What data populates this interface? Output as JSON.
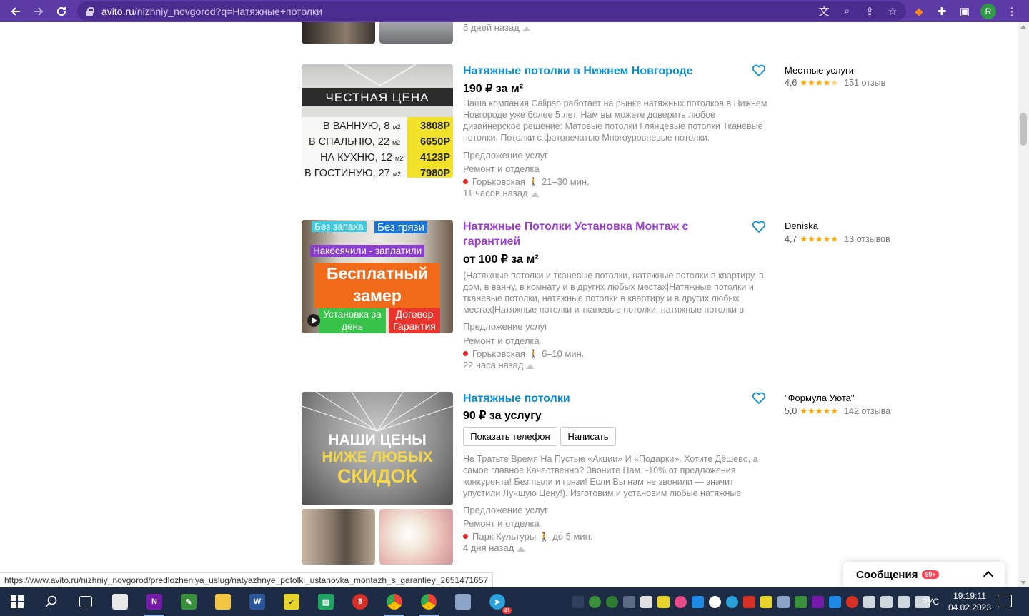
{
  "browser": {
    "url_host": "avito.ru",
    "url_rest": "/nizhniy_novgorod?q=Натяжные+потолки",
    "avatar_letter": "R"
  },
  "partial_top": {
    "time": "5 дней назад"
  },
  "listings": [
    {
      "title": "Натяжные потолки в Нижнем Новгороде",
      "price": "190 ₽ за м²",
      "description": "Наша компания Calipso работает на рынке натяжных потолков в Нижнем Новгороде уже более 5 лет. Нам вы можете доверить любое дизайнерское решение: Матовые потолки Глянцевые потолки Тканевые потолки. Потолки с фотопечатью Многоуровневые потолки.",
      "category1": "Предложение услуг",
      "category2": "Ремонт и отделка",
      "metro": "Горьковская",
      "walk": "21–30 мин.",
      "time": "11 часов назад",
      "seller": "Местные услуги",
      "rating": "4,6",
      "reviews": "151 отзыв",
      "image_text": {
        "header": "ЧЕСТНАЯ ЦЕНА",
        "rows": [
          {
            "label": "В ВАННУЮ, 8",
            "unit": "м2",
            "price": "3808Р"
          },
          {
            "label": "В СПАЛЬНЮ, 22",
            "unit": "м2",
            "price": "6650Р"
          },
          {
            "label": "НА КУХНЮ, 12",
            "unit": "м2",
            "price": "4123Р"
          },
          {
            "label": "В ГОСТИНУЮ, 27",
            "unit": "м2",
            "price": "7980Р"
          }
        ]
      }
    },
    {
      "title": "Натяжные Потолки Установка Монтаж с гарантией",
      "price": "от 100 ₽ за м²",
      "description": "{Натяжные потолки и тканевые потолки, натяжные потолки в квартиру, в дом, в ванну, в комнату и в других любых местах|Натяжные потолки и тканевые потолки, натяжные потолки в квартиру и в других любых местах|Натяжные потолки и тканевые потолки, натяжные потолки в",
      "category1": "Предложение услуг",
      "category2": "Ремонт и отделка",
      "metro": "Горьковская",
      "walk": "6–10 мин.",
      "time": "22 часа назад",
      "seller": "Deniska",
      "rating": "4,7",
      "reviews": "13 отзывов",
      "image_text": {
        "tag1": "Без запаха",
        "tag2": "Без грязи",
        "tag3": "Накосячили - заплатили",
        "big": "Бесплатный замер",
        "bl": "Установка за день",
        "br": "Договор Гарантия"
      }
    },
    {
      "title": "Натяжные потолки",
      "price": "90 ₽ за услугу",
      "button_phone": "Показать телефон",
      "button_write": "Написать",
      "description": "Не Тратьте Время На Пустые «Акции» И «Подарки». Хотите Дёшево, а самое главное Качественно? Звоните Нам. -10% от предложения конкурента! Без пыли и грязи! Если Вы нам не звонили — значит упустили Лучшую Цену!). Изготовим и установим любые натяжные",
      "category1": "Предложение услуг",
      "category2": "Ремонт и отделка",
      "metro": "Парк Культуры",
      "walk": "до 5 мин.",
      "time": "4 дня назад",
      "seller": "\"Формула Уюта\"",
      "rating": "5,0",
      "reviews": "142 отзыва",
      "image_text": {
        "l1": "НАШИ ЦЕНЫ",
        "l2": "НИЖЕ ЛЮБЫХ",
        "l3": "СКИДОК"
      }
    }
  ],
  "status_url": "https://www.avito.ru/nizhniy_novgorod/predlozheniya_uslug/natyazhnye_potolki_ustanovka_montazh_s_garantiey_2651471657",
  "messages": {
    "label": "Сообщения",
    "badge": "99+"
  },
  "taskbar": {
    "lang": "РУС",
    "time": "19:19:11",
    "date": "04.02.2023",
    "telegram_badge": "41"
  }
}
